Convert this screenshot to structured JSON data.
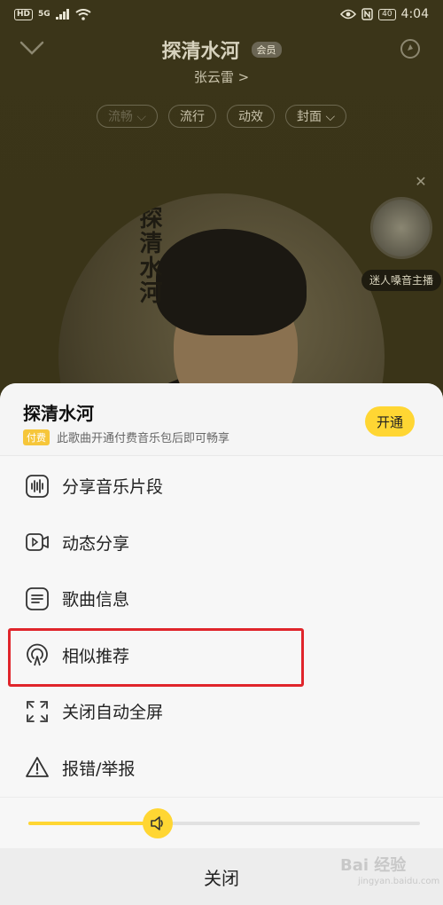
{
  "status_bar": {
    "network_left": "HD",
    "network_type": "5G",
    "battery": "40",
    "time": "4:04"
  },
  "player": {
    "song_title": "探清水河",
    "vip_badge": "会员",
    "artist": "张云雷 >",
    "chips": [
      {
        "label": "流畅 ⌵"
      },
      {
        "label": "流行"
      },
      {
        "label": "动效"
      },
      {
        "label": "封面 ⌵"
      }
    ],
    "cover_text": "探清水河",
    "float_label": "迷人嗓音主播"
  },
  "sheet": {
    "title": "探清水河",
    "pay_badge": "付费",
    "pay_text": "此歌曲开通付费音乐包后即可畅享",
    "open_button": "开通",
    "menu_items": [
      {
        "label": "分享音乐片段",
        "icon": "audio-wave-icon"
      },
      {
        "label": "动态分享",
        "icon": "video-share-icon"
      },
      {
        "label": "歌曲信息",
        "icon": "document-info-icon"
      },
      {
        "label": "相似推荐",
        "icon": "broadcast-icon"
      },
      {
        "label": "关闭自动全屏",
        "icon": "fullscreen-icon"
      },
      {
        "label": "报错/举报",
        "icon": "warning-icon"
      }
    ],
    "volume_level": 0.33,
    "close_label": "关闭"
  },
  "watermark": {
    "text": "Bai 经验",
    "sub": "jingyan.baidu.com"
  },
  "colors": {
    "accent": "#ffd633",
    "highlight_border": "#e0252b"
  }
}
